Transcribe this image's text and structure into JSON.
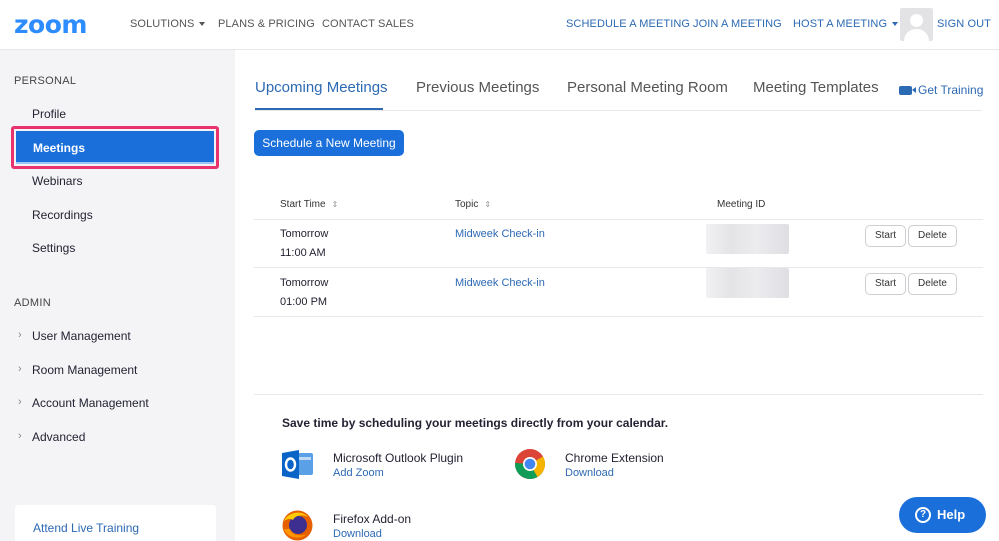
{
  "brand": {
    "logo_text": "zoom",
    "accent": "#2D8CFF",
    "primary": "#1A6FDB",
    "link": "#2D6AB4",
    "highlight_border": "#E8336F"
  },
  "topnav": {
    "solutions": "SOLUTIONS",
    "plans": "PLANS & PRICING",
    "contact": "CONTACT SALES",
    "schedule": "SCHEDULE A MEETING",
    "join": "JOIN A MEETING",
    "host": "HOST A MEETING",
    "signout": "SIGN OUT"
  },
  "sidebar": {
    "personal_header": "PERSONAL",
    "personal_items": [
      "Profile",
      "Meetings",
      "Webinars",
      "Recordings",
      "Settings"
    ],
    "active_item": "Meetings",
    "admin_header": "ADMIN",
    "admin_items": [
      "User Management",
      "Room Management",
      "Account Management",
      "Advanced"
    ],
    "bottom_link": "Attend Live Training"
  },
  "tabs": [
    "Upcoming Meetings",
    "Previous Meetings",
    "Personal Meeting Room",
    "Meeting Templates"
  ],
  "active_tab": "Upcoming Meetings",
  "get_training": "Get Training",
  "schedule_button": "Schedule a New Meeting",
  "table": {
    "headers": {
      "start_time": "Start Time",
      "topic": "Topic",
      "meeting_id": "Meeting ID"
    },
    "rows": [
      {
        "day": "Tomorrow",
        "time": "11:00 AM",
        "topic": "Midweek Check-in",
        "start": "Start",
        "delete": "Delete"
      },
      {
        "day": "Tomorrow",
        "time": "01:00 PM",
        "topic": "Midweek Check-in",
        "start": "Start",
        "delete": "Delete"
      }
    ]
  },
  "calendar": {
    "title": "Save time by scheduling your meetings directly from your calendar.",
    "plugins": [
      {
        "name": "Microsoft Outlook Plugin",
        "link": "Add Zoom",
        "icon": "outlook-icon"
      },
      {
        "name": "Chrome Extension",
        "link": "Download",
        "icon": "chrome-icon"
      },
      {
        "name": "Firefox Add-on",
        "link": "Download",
        "icon": "firefox-icon"
      }
    ]
  },
  "help_button": "Help"
}
